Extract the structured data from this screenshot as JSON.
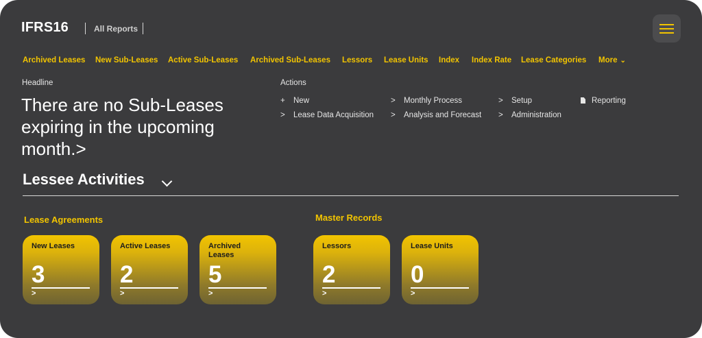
{
  "header": {
    "app_title": "IFRS16",
    "all_reports": "All Reports",
    "menu_icon": "hamburger-menu-icon"
  },
  "nav": {
    "items": [
      {
        "label": "Archived Leases"
      },
      {
        "label": "New Sub-Leases"
      },
      {
        "label": "Active Sub-Leases"
      },
      {
        "label": "Archived Sub-Leases"
      },
      {
        "label": "Lessors"
      },
      {
        "label": "Lease Units"
      },
      {
        "label": "Index"
      },
      {
        "label": "Index Rate"
      },
      {
        "label": "Lease Categories"
      },
      {
        "label": "More"
      }
    ]
  },
  "headline": {
    "label": "Headline",
    "text": "There are no Sub-Leases expiring in the upcoming month.>"
  },
  "actions": {
    "label": "Actions",
    "items": [
      {
        "glyph": "+",
        "label": "New"
      },
      {
        "glyph": ">",
        "label": "Lease Data Acquisition"
      },
      {
        "glyph": ">",
        "label": "Monthly Process"
      },
      {
        "glyph": ">",
        "label": "Analysis and Forecast"
      },
      {
        "glyph": ">",
        "label": "Setup"
      },
      {
        "glyph": ">",
        "label": "Administration"
      },
      {
        "glyph": "document-icon",
        "label": "Reporting"
      }
    ]
  },
  "section": {
    "title": "Lessee Activities"
  },
  "groups": {
    "lease_agreements": {
      "label": "Lease Agreements",
      "cards": [
        {
          "label": "New Leases",
          "value": "3",
          "chevron": ">"
        },
        {
          "label": "Active Leases",
          "value": "2",
          "chevron": ">"
        },
        {
          "label": "Archived Leases",
          "value": "5",
          "chevron": ">"
        }
      ]
    },
    "master_records": {
      "label": "Master Records",
      "cards": [
        {
          "label": "Lessors",
          "value": "2",
          "chevron": ">"
        },
        {
          "label": "Lease Units",
          "value": "0",
          "chevron": ">"
        }
      ]
    }
  },
  "colors": {
    "background": "#3b3b3d",
    "accent": "#f2c400",
    "text": "#ffffff"
  }
}
